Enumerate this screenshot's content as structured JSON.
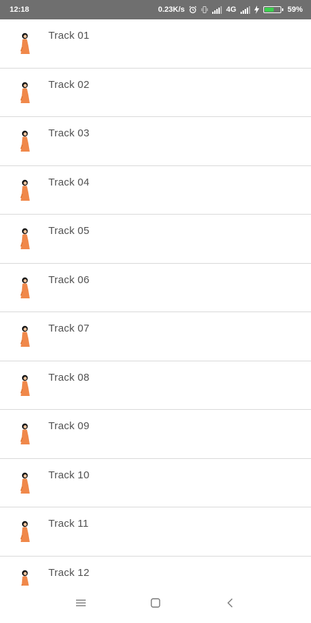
{
  "status_bar": {
    "time": "12:18",
    "network_speed": "0.23K/s",
    "network_type": "4G",
    "battery_percent": "59%",
    "battery_level": 0.59,
    "battery_color": "#3ccf4e",
    "icons": [
      "alarm-icon",
      "vibrate-icon",
      "signal-icon",
      "signal-icon",
      "charging-icon",
      "battery-icon"
    ]
  },
  "tracks": [
    {
      "label": "Track 01",
      "icon": "artist-figure-icon"
    },
    {
      "label": "Track 02",
      "icon": "artist-figure-icon"
    },
    {
      "label": "Track 03",
      "icon": "artist-figure-icon"
    },
    {
      "label": "Track 04",
      "icon": "artist-figure-icon"
    },
    {
      "label": "Track 05",
      "icon": "artist-figure-icon"
    },
    {
      "label": "Track 06",
      "icon": "artist-figure-icon"
    },
    {
      "label": "Track 07",
      "icon": "artist-figure-icon"
    },
    {
      "label": "Track 08",
      "icon": "artist-figure-icon"
    },
    {
      "label": "Track 09",
      "icon": "artist-figure-icon"
    },
    {
      "label": "Track 10",
      "icon": "artist-figure-icon"
    },
    {
      "label": "Track 11",
      "icon": "artist-figure-icon"
    },
    {
      "label": "Track 12",
      "icon": "artist-figure-icon"
    }
  ],
  "nav_bar": {
    "buttons": [
      "menu-icon",
      "home-square-icon",
      "back-chevron-icon"
    ]
  },
  "colors": {
    "status_bar_bg": "#6f6f6f",
    "figure_orange": "#f0884a",
    "divider": "#d9d9d9",
    "text": "#505050"
  }
}
